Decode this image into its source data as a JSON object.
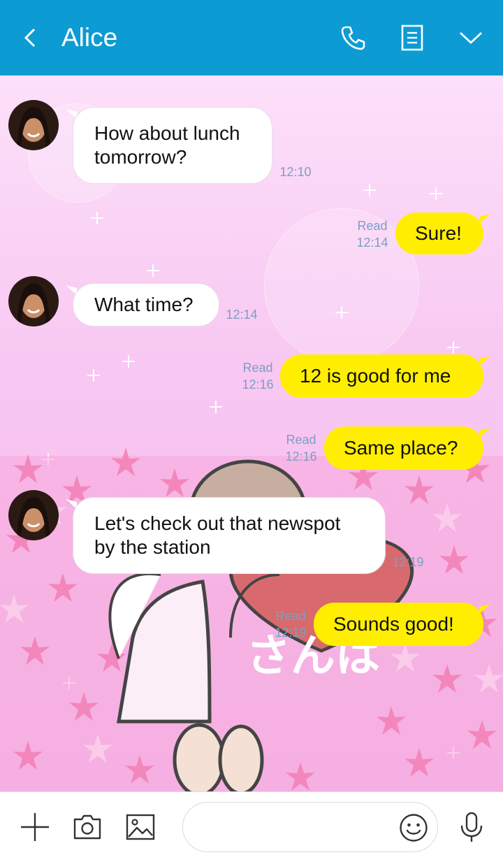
{
  "header": {
    "contact_name": "Alice",
    "icons": [
      "back-icon",
      "phone-icon",
      "notes-icon",
      "chevron-down-icon"
    ],
    "background_color": "#0d9bd4"
  },
  "theme": {
    "background_colors": [
      "#fce0fa",
      "#f7b8ee"
    ],
    "sticker_text": "さんは"
  },
  "messages": [
    {
      "side": "left",
      "text": "How about lunch tomorrow?",
      "time": "12:10"
    },
    {
      "side": "right",
      "text": "Sure!",
      "read": "Read",
      "time": "12:14"
    },
    {
      "side": "left",
      "text": "What time?",
      "time": "12:14"
    },
    {
      "side": "right",
      "text": "12 is good for me",
      "read": "Read",
      "time": "12:16"
    },
    {
      "side": "right",
      "text": "Same place?",
      "read": "Read",
      "time": "12:16"
    },
    {
      "side": "left",
      "text": "Let's check out that newspot by the station",
      "time": "12:19"
    },
    {
      "side": "right",
      "text": "Sounds good!",
      "read": "Read",
      "time": "12:19"
    }
  ],
  "colors": {
    "sent_bubble": "#ffee00",
    "received_bubble": "#ffffff",
    "meta_text": "#7b9fc0"
  },
  "input_bar": {
    "icons": [
      "plus-icon",
      "camera-icon",
      "image-icon",
      "emoji-icon",
      "microphone-icon"
    ],
    "message_value": "",
    "message_placeholder": ""
  }
}
